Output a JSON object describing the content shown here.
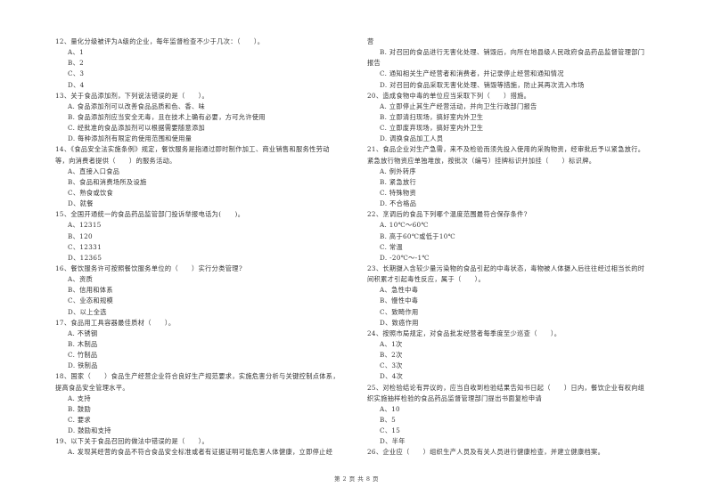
{
  "left_column": [
    {
      "type": "q",
      "text": "12、量化分级被评为A级的企业，每年监督检查不少于几次：（　　）。"
    },
    {
      "type": "opt",
      "text": "A、1"
    },
    {
      "type": "opt",
      "text": "B、2"
    },
    {
      "type": "opt",
      "text": "C、3"
    },
    {
      "type": "opt",
      "text": "D、4"
    },
    {
      "type": "q",
      "text": "13、关于食品添加剂，下列说法错误的是（　　）。"
    },
    {
      "type": "opt",
      "text": "A. 食品添加剂可以改善食品品质和色、香、味"
    },
    {
      "type": "opt",
      "text": "B. 食品添加剂应当安全无毒，且在技术上确有必要，方可允许使用"
    },
    {
      "type": "opt",
      "text": "C. 经批准的食品添加剂可以根据需要随意添加"
    },
    {
      "type": "opt",
      "text": "D. 每种添加剂有限定的使用范围和使用量"
    },
    {
      "type": "q",
      "text": "14、《食品安全法实施条例》规定，餐饮服务是指通过即时制作加工、商业销售和服务性劳动"
    },
    {
      "type": "cont",
      "text": "等，向消费者提供（　　）的服务活动。"
    },
    {
      "type": "opt",
      "text": "A、直接入口食品"
    },
    {
      "type": "opt",
      "text": "B、食品和消费场所及设施"
    },
    {
      "type": "opt",
      "text": "C、熟食或饮食"
    },
    {
      "type": "opt",
      "text": "D、就餐"
    },
    {
      "type": "q",
      "text": "15、全国开通统一的食品药品监管部门投诉举报电话为(　　)。"
    },
    {
      "type": "opt",
      "text": "A、12315"
    },
    {
      "type": "opt",
      "text": "B、120"
    },
    {
      "type": "opt",
      "text": "C、12331"
    },
    {
      "type": "opt",
      "text": "D、12365"
    },
    {
      "type": "q",
      "text": "16、餐饮服务许可按照餐饮服务单位的（　　）实行分类管理?"
    },
    {
      "type": "opt",
      "text": "A、资质"
    },
    {
      "type": "opt",
      "text": "B、信用和体系"
    },
    {
      "type": "opt",
      "text": "C、业态和规模"
    },
    {
      "type": "opt",
      "text": "D、以上全选"
    },
    {
      "type": "q",
      "text": "17、食品用工具容器最佳质材（　　）。"
    },
    {
      "type": "opt",
      "text": "A. 不锈钢"
    },
    {
      "type": "opt",
      "text": "B. 木制品"
    },
    {
      "type": "opt",
      "text": "C. 竹制品"
    },
    {
      "type": "opt",
      "text": "D. 铁制品"
    },
    {
      "type": "q",
      "text": "18、国家（　　）食品生产经营企业符合良好生产规范要求，实施危害分析与关键控制点体系，"
    },
    {
      "type": "cont",
      "text": "提高食品安全管理水平。"
    },
    {
      "type": "opt",
      "text": "A. 支持"
    },
    {
      "type": "opt",
      "text": "B. 鼓励"
    },
    {
      "type": "opt",
      "text": "C. 要求"
    },
    {
      "type": "opt",
      "text": "D. 鼓励和支持"
    },
    {
      "type": "q",
      "text": "19、以下关于食品召回的做法中错误的是（　　）。"
    },
    {
      "type": "opt",
      "text": "A. 发现其经营的食品不符合食品安全标准或者有证据证明可能危害人体健康，立即停止经"
    }
  ],
  "right_column": [
    {
      "type": "cont",
      "text": "营"
    },
    {
      "type": "opt",
      "text": "B. 对召回的食品进行无害化处理、销毁后，向所在地县级人民政府食品药品监督管理部门"
    },
    {
      "type": "cont",
      "text": "报告"
    },
    {
      "type": "opt",
      "text": "C. 通知相关生产经营者和消费者，并记录停止经营和通知情况"
    },
    {
      "type": "opt",
      "text": "D. 对召回的食品采取无害化处理、销毁等措施，防止其再次流入市场"
    },
    {
      "type": "q",
      "text": "20、造成食物中毒的单位应当采取下列（　　）措施。"
    },
    {
      "type": "opt",
      "text": "A. 立即停止其生产经营活动，并向卫生行政部门报告"
    },
    {
      "type": "opt",
      "text": "B. 立即清扫现场，搞好室内外卫生"
    },
    {
      "type": "opt",
      "text": "C. 立即废弃现场，搞好室内外卫生"
    },
    {
      "type": "opt",
      "text": "D. 调换食品加工人员"
    },
    {
      "type": "q",
      "text": "21、食品企业对生产急需，来不及检验而须先投入使用的采购物资，经审批后予以紧急放行。"
    },
    {
      "type": "cont",
      "text": "紧急放行物资应单独堆放，按批次（编号）挂牌标识并加挂（　　）标识牌。"
    },
    {
      "type": "opt",
      "text": "A. 例外转序"
    },
    {
      "type": "opt",
      "text": "B. 紧急放行"
    },
    {
      "type": "opt",
      "text": "C. 特殊物资"
    },
    {
      "type": "opt",
      "text": "D. 不合格品"
    },
    {
      "type": "q",
      "text": "22、烹调后的食品下列哪个温度范围最符合保存条件?"
    },
    {
      "type": "opt",
      "text": "A. 10℃～60℃"
    },
    {
      "type": "opt",
      "text": "B. 高于60℃或低于10℃"
    },
    {
      "type": "opt",
      "text": "C. 常温"
    },
    {
      "type": "opt",
      "text": "D. -20℃～-1℃"
    },
    {
      "type": "q",
      "text": "23、长期摄入含较少量污染物的食品引起的中毒状态，毒物被人体摄入后往往经过相当长的时"
    },
    {
      "type": "cont",
      "text": "间积累才引起毒性反应，属于（　　）。"
    },
    {
      "type": "opt",
      "text": "A、急性中毒"
    },
    {
      "type": "opt",
      "text": "B、慢性中毒"
    },
    {
      "type": "opt",
      "text": "C、致畸作用"
    },
    {
      "type": "opt",
      "text": "D、致癌作用"
    },
    {
      "type": "q",
      "text": "24、按照市局规定，对食品批发经营者每季度至少巡查（　　）。"
    },
    {
      "type": "opt",
      "text": "A、1次"
    },
    {
      "type": "opt",
      "text": "B、2次"
    },
    {
      "type": "opt",
      "text": "C、3次"
    },
    {
      "type": "opt",
      "text": "D、4次"
    },
    {
      "type": "q",
      "text": "25、对检验结论有异议的，应当自收到检验结果告知书日起（　　）日内，餐饮企业有权向组"
    },
    {
      "type": "cont",
      "text": "织实施抽样检验的食品药品监督管理部门提出书面复检申请"
    },
    {
      "type": "opt",
      "text": "A、10"
    },
    {
      "type": "opt",
      "text": "B、5"
    },
    {
      "type": "opt",
      "text": "C、15"
    },
    {
      "type": "opt",
      "text": "D、半年"
    },
    {
      "type": "q",
      "text": "26、企业应（　　）组织生产人员及有关人员进行健康检查，并建立健康档案。"
    }
  ],
  "footer": {
    "page_label": "第 2 页 共 8 页"
  }
}
